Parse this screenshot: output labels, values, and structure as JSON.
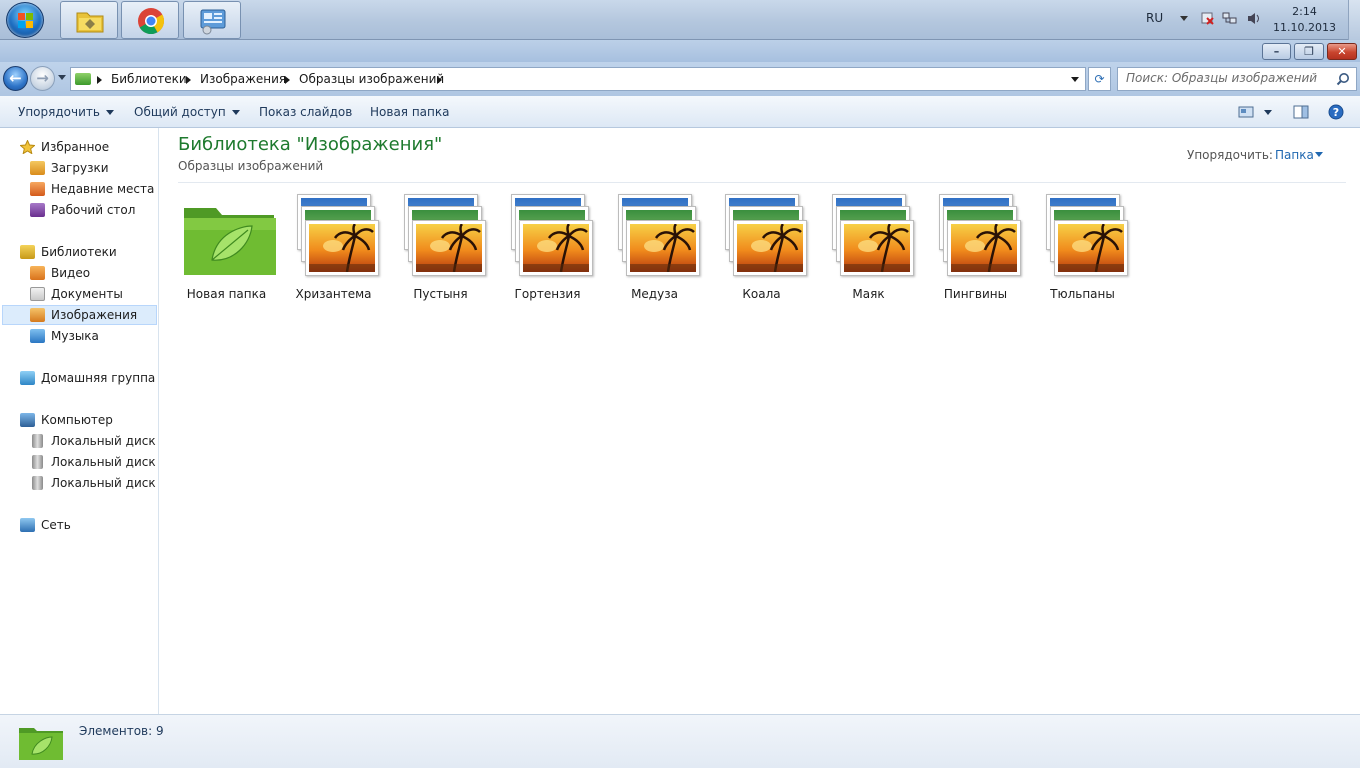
{
  "taskbar": {
    "start_icon": "windows-start-orb",
    "pinned": [
      {
        "name": "explorer-libraries",
        "icon": "folder-libraries-icon"
      },
      {
        "name": "chrome",
        "icon": "chrome-icon"
      },
      {
        "name": "control-panel",
        "icon": "control-panel-icon"
      }
    ],
    "tray": {
      "language": "RU",
      "time": "2:14",
      "date": "11.10.2013"
    }
  },
  "window": {
    "controls": {
      "minimize": "–",
      "maximize": "❐",
      "close": "✕"
    }
  },
  "address": {
    "breadcrumbs": [
      "Библиотеки",
      "Изображения",
      "Образцы изображений"
    ],
    "search_placeholder": "Поиск: Образцы изображений"
  },
  "toolbar": {
    "organize": "Упорядочить",
    "share": "Общий доступ",
    "slideshow": "Показ слайдов",
    "new_folder": "Новая папка"
  },
  "navpane": {
    "favorites": {
      "label": "Избранное",
      "items": [
        "Загрузки",
        "Недавние места",
        "Рабочий стол"
      ]
    },
    "libraries": {
      "label": "Библиотеки",
      "items": [
        "Видео",
        "Документы",
        "Изображения",
        "Музыка"
      ],
      "selected": "Изображения"
    },
    "homegroup": {
      "label": "Домашняя группа"
    },
    "computer": {
      "label": "Компьютер",
      "items": [
        "Локальный диск (C",
        "Локальный диск (D",
        "Локальный диск (E:"
      ]
    },
    "network": {
      "label": "Сеть"
    }
  },
  "content": {
    "title": "Библиотека \"Изображения\"",
    "subtitle": "Образцы изображений",
    "arrange_label": "Упорядочить:",
    "arrange_value": "Папка",
    "items": [
      {
        "name": "Новая папка",
        "type": "folder"
      },
      {
        "name": "Хризантема",
        "type": "image"
      },
      {
        "name": "Пустыня",
        "type": "image"
      },
      {
        "name": "Гортензия",
        "type": "image"
      },
      {
        "name": "Медуза",
        "type": "image"
      },
      {
        "name": "Коала",
        "type": "image"
      },
      {
        "name": "Маяк",
        "type": "image"
      },
      {
        "name": "Пингвины",
        "type": "image"
      },
      {
        "name": "Тюльпаны",
        "type": "image"
      }
    ]
  },
  "status": {
    "text": "Элементов: 9"
  },
  "colors": {
    "title_green": "#1e7a2e",
    "link_blue": "#1f67b0",
    "selection": "#dcecfc"
  }
}
